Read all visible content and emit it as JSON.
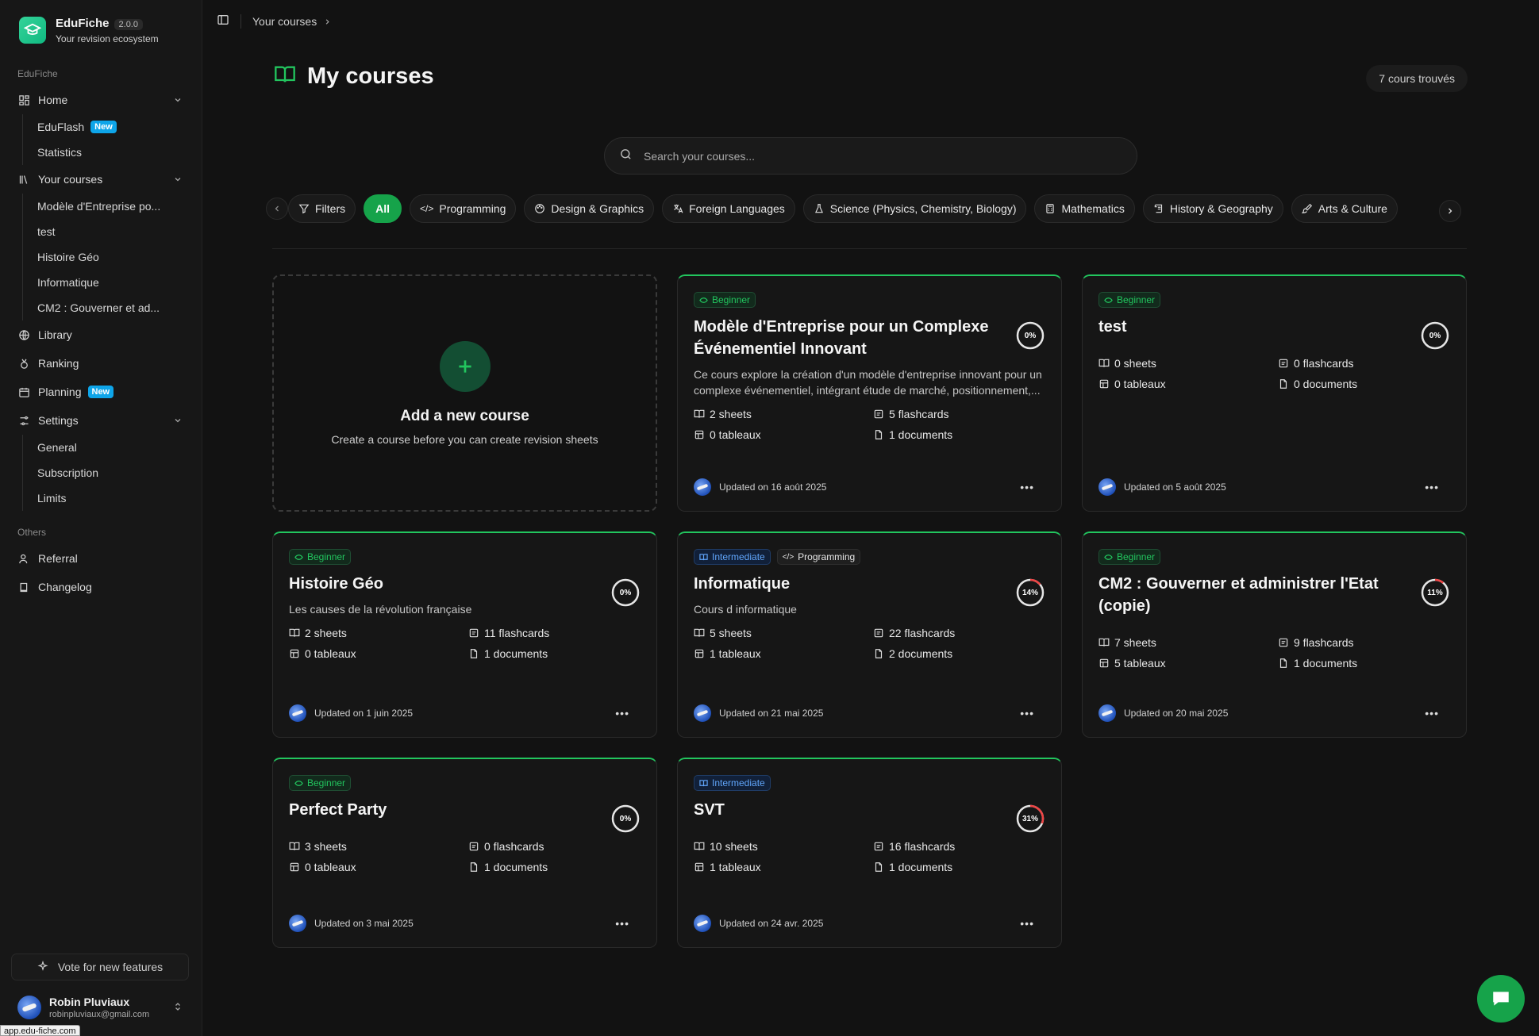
{
  "brand": {
    "name": "EduFiche",
    "version": "2.0.0",
    "tagline": "Your revision ecosystem"
  },
  "sidebar": {
    "group1": "EduFiche",
    "home": {
      "label": "Home",
      "items": [
        {
          "label": "EduFlash",
          "badge": "New"
        },
        {
          "label": "Statistics"
        }
      ]
    },
    "courses": {
      "label": "Your courses",
      "items": [
        "Modèle d'Entreprise po...",
        "test",
        "Histoire Géo",
        "Informatique",
        "CM2 : Gouverner et ad..."
      ]
    },
    "library": "Library",
    "ranking": "Ranking",
    "planning": {
      "label": "Planning",
      "badge": "New"
    },
    "settings": {
      "label": "Settings",
      "items": [
        "General",
        "Subscription",
        "Limits"
      ]
    },
    "group2": "Others",
    "referral": "Referral",
    "changelog": "Changelog",
    "vote": "Vote for new features",
    "user": {
      "name": "Robin Pluviaux",
      "email": "robinpluviaux@gmail.com"
    }
  },
  "status_url": "app.edu-fiche.com",
  "breadcrumb": "Your courses",
  "page": {
    "title": "My courses",
    "count": "7 cours trouvés"
  },
  "search": {
    "placeholder": "Search your courses..."
  },
  "filters": {
    "filters_label": "Filters",
    "all": "All",
    "categories": [
      "Programming",
      "Design & Graphics",
      "Foreign Languages",
      "Science (Physics, Chemistry, Biology)",
      "Mathematics",
      "History & Geography",
      "Arts & Culture"
    ]
  },
  "add_card": {
    "title": "Add a new course",
    "subtitle": "Create a course before you can create revision sheets"
  },
  "colors": {
    "accent": "#22c55e",
    "beginner": "#22c55e",
    "intermediate": "#60a5fa",
    "progress_track": "#e5e5e5",
    "progress_fill": "#ef4444"
  },
  "courses": [
    {
      "tags": [
        "Beginner"
      ],
      "title": "Modèle d'Entreprise pour un Complexe Événementiel Innovant",
      "progress": "0%",
      "progress_value": 0,
      "description": "Ce cours explore la création d'un modèle d'entreprise innovant pour un complexe événementiel, intégrant étude de marché, positionnement,...",
      "sheets": "2 sheets",
      "flashcards": "5 flashcards",
      "tableaux": "0 tableaux",
      "documents": "1 documents",
      "updated": "Updated on 16 août 2025"
    },
    {
      "tags": [
        "Beginner"
      ],
      "title": "test",
      "progress": "0%",
      "progress_value": 0,
      "description": "",
      "sheets": "0 sheets",
      "flashcards": "0 flashcards",
      "tableaux": "0 tableaux",
      "documents": "0 documents",
      "updated": "Updated on 5 août 2025"
    },
    {
      "tags": [
        "Beginner"
      ],
      "title": "Histoire Géo",
      "progress": "0%",
      "progress_value": 0,
      "description": "Les causes de la révolution française",
      "sheets": "2 sheets",
      "flashcards": "11 flashcards",
      "tableaux": "0 tableaux",
      "documents": "1 documents",
      "updated": "Updated on 1 juin 2025"
    },
    {
      "tags": [
        "Intermediate",
        "Programming"
      ],
      "title": "Informatique",
      "progress": "14%",
      "progress_value": 14,
      "description": "Cours d informatique",
      "sheets": "5 sheets",
      "flashcards": "22 flashcards",
      "tableaux": "1 tableaux",
      "documents": "2 documents",
      "updated": "Updated on 21 mai 2025"
    },
    {
      "tags": [
        "Beginner"
      ],
      "title": "CM2 : Gouverner et administrer l'Etat (copie)",
      "progress": "11%",
      "progress_value": 11,
      "description": "",
      "sheets": "7 sheets",
      "flashcards": "9 flashcards",
      "tableaux": "5 tableaux",
      "documents": "1 documents",
      "updated": "Updated on 20 mai 2025"
    },
    {
      "tags": [
        "Beginner"
      ],
      "title": "Perfect Party",
      "progress": "0%",
      "progress_value": 0,
      "description": "",
      "sheets": "3 sheets",
      "flashcards": "0 flashcards",
      "tableaux": "0 tableaux",
      "documents": "1 documents",
      "updated": "Updated on 3 mai 2025"
    },
    {
      "tags": [
        "Intermediate"
      ],
      "title": "SVT",
      "progress": "31%",
      "progress_value": 31,
      "description": "",
      "sheets": "10 sheets",
      "flashcards": "16 flashcards",
      "tableaux": "1 tableaux",
      "documents": "1 documents",
      "updated": "Updated on 24 avr. 2025"
    }
  ]
}
